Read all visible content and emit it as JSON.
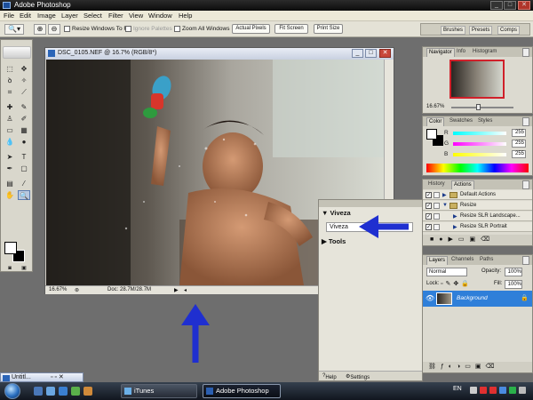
{
  "window": {
    "title": "Adobe Photoshop"
  },
  "menu": [
    "File",
    "Edit",
    "Image",
    "Layer",
    "Select",
    "Filter",
    "View",
    "Window",
    "Help"
  ],
  "options_bar": {
    "resize_windows": "Resize Windows To Fit",
    "ignore_palettes": "Ignore Palettes",
    "zoom_all": "Zoom All Windows",
    "actual_pixels": "Actual Pixels",
    "fit_screen": "Fit Screen",
    "print_size": "Print Size",
    "well_tabs": [
      "Brushes",
      "Presets",
      "Comps"
    ]
  },
  "document": {
    "title": "DSC_0105.NEF @ 16.7% (RGB/8*)",
    "zoom": "16.67%",
    "doc_size": "Doc: 28.7M/28.7M"
  },
  "navigator": {
    "tabs": [
      "Navigator",
      "Info",
      "Histogram"
    ],
    "zoom": "16.67%"
  },
  "color_panel": {
    "tabs": [
      "Color",
      "Swatches",
      "Styles"
    ],
    "channels": [
      {
        "label": "R",
        "value": "255"
      },
      {
        "label": "G",
        "value": "255"
      },
      {
        "label": "B",
        "value": "255"
      }
    ]
  },
  "actions_panel": {
    "tabs": [
      "History",
      "Actions"
    ],
    "rows": [
      "Default Actions",
      "Resize",
      "Resize SLR Landscape...",
      "Resize SLR Portrait"
    ]
  },
  "layers_panel": {
    "tabs": [
      "Layers",
      "Channels",
      "Paths"
    ],
    "blend_mode": "Normal",
    "opacity_label": "Opacity:",
    "opacity": "100%",
    "lock_label": "Lock:",
    "fill_label": "Fill:",
    "fill": "100%",
    "layer_name": "Background"
  },
  "viveza_panel": {
    "section": "Viveza",
    "button": "Viveza",
    "tools": "Tools",
    "help": "Help",
    "settings": "Settings"
  },
  "minimized_window": {
    "title": "Untitl..."
  },
  "taskbar": {
    "tasks": [
      "iTunes",
      "Adobe Photoshop"
    ],
    "language": "EN"
  },
  "colors": {
    "annotation_arrow": "#1f2fd0",
    "layer_selected": "#2f7fd9",
    "taskbar": "#1b222d"
  }
}
